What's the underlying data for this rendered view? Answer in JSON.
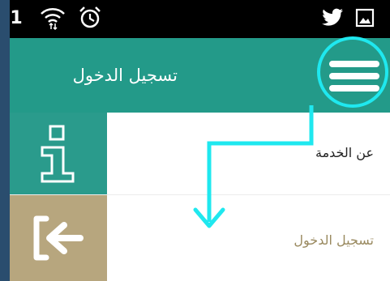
{
  "status_bar": {
    "notification_count": "1",
    "icons": [
      "wifi-icon",
      "alarm-icon",
      "twitter-icon",
      "gallery-icon"
    ]
  },
  "app_bar": {
    "title": "تسجيل الدخول",
    "menu_icon": "hamburger-menu-icon"
  },
  "menu": {
    "items": [
      {
        "label": "عن الخدمة",
        "icon": "info-icon",
        "icon_bg": "#2a9b8c"
      },
      {
        "label": "تسجيل الدخول",
        "icon": "login-arrow-icon",
        "icon_bg": "#b7a67e"
      }
    ]
  },
  "colors": {
    "app_bar": "#239a89",
    "annotation": "#1fe8ef",
    "outer_background": "#2a4d6e"
  }
}
